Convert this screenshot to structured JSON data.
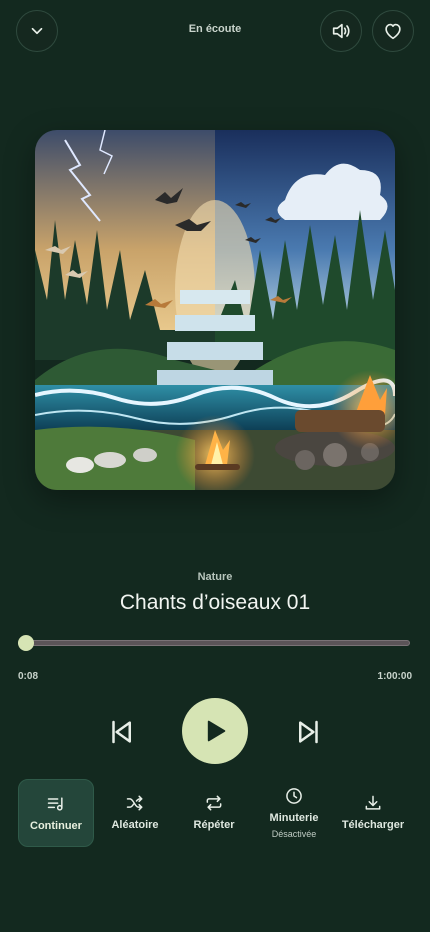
{
  "header": {
    "title": "En écoute"
  },
  "track": {
    "category": "Nature",
    "title": "Chants d’oiseaux 01",
    "current_time": "0:08",
    "total_time": "1:00:00",
    "progress_fraction": 0.0022
  },
  "modes": [
    {
      "label": "Continuer",
      "sublabel": "",
      "icon": "queue-music-icon",
      "active": true
    },
    {
      "label": "Aléatoire",
      "sublabel": "",
      "icon": "shuffle-icon",
      "active": false
    },
    {
      "label": "Répéter",
      "sublabel": "",
      "icon": "repeat-icon",
      "active": false
    },
    {
      "label": "Minuterie",
      "sublabel": "Désactivée",
      "icon": "clock-icon",
      "active": false
    },
    {
      "label": "Télécharger",
      "sublabel": "",
      "icon": "download-icon",
      "active": false
    }
  ],
  "colors": {
    "background": "#13291f",
    "accent": "#d6e4b4",
    "active_mode": "#24463a"
  }
}
